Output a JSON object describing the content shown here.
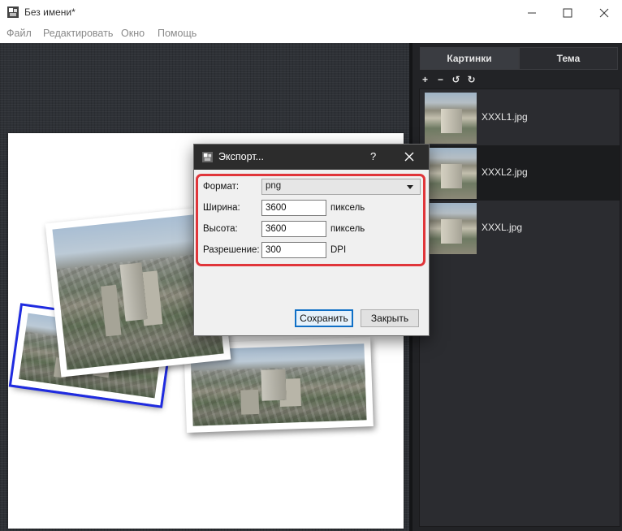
{
  "window": {
    "title": "Без имени*",
    "app_icon": "collage-app-icon",
    "controls": {
      "minimize_icon": "minimize-icon",
      "maximize_icon": "maximize-icon",
      "close_icon": "close-icon"
    }
  },
  "menu": {
    "items": [
      "Файл",
      "Редактировать",
      "Окно",
      "Помощь"
    ]
  },
  "right_panel": {
    "tabs": [
      {
        "label": "Картинки",
        "active": true
      },
      {
        "label": "Тема",
        "active": false
      }
    ],
    "toolbar": [
      {
        "glyph": "+",
        "icon": "add-icon"
      },
      {
        "glyph": "−",
        "icon": "remove-icon"
      },
      {
        "glyph": "↺",
        "icon": "rotate-left-icon"
      },
      {
        "glyph": "↻",
        "icon": "rotate-right-icon"
      }
    ],
    "images": [
      {
        "name": "XXXL1.jpg",
        "selected": false
      },
      {
        "name": "XXXL2.jpg",
        "selected": true
      },
      {
        "name": "XXXL.jpg",
        "selected": false
      }
    ]
  },
  "dialog": {
    "title": "Экспорт...",
    "help": "?",
    "format_label": "Формат:",
    "format_value": "png",
    "width_label": "Ширина:",
    "width_value": "3600",
    "width_unit": "пиксель",
    "height_label": "Высота:",
    "height_value": "3600",
    "height_unit": "пиксель",
    "resolution_label": "Разрешение:",
    "resolution_value": "300",
    "resolution_unit": "DPI",
    "save_label": "Сохранить",
    "close_label": "Закрыть"
  },
  "colors": {
    "highlight": "#e0353a",
    "selected_photo_border": "#1f2be0",
    "primary_button_border": "#0f6fc6",
    "panel_bg": "#222326"
  }
}
